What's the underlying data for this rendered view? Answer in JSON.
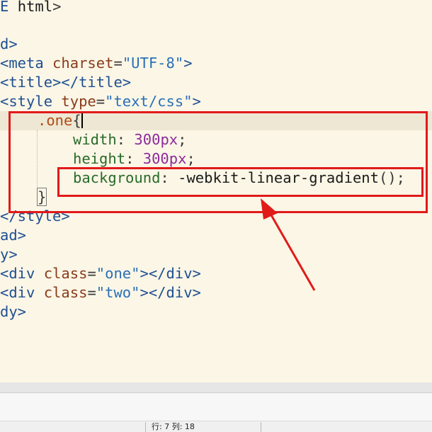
{
  "editor": {
    "lines": {
      "l1": {
        "a": "E ",
        "b": "html",
        "c": ">"
      },
      "l2": {
        "a": "d",
        "b": ">"
      },
      "l3": {
        "lt": "<",
        "tag": "meta",
        "attr": " charset",
        "eq": "=",
        "str": "\"UTF-8\"",
        "gt": ">"
      },
      "l4": {
        "text": "<title></title>"
      },
      "l5": {
        "lt": "<",
        "tag": "style",
        "attr": " type",
        "eq": "=",
        "str": "\"text/css\"",
        "gt": ">"
      },
      "l6": {
        "sel": ".one",
        "brace": "{"
      },
      "l7": {
        "prop": "width",
        "colon": ": ",
        "num": "300",
        "unit": "px",
        "semi": ";"
      },
      "l8": {
        "prop": "height",
        "colon": ": ",
        "num": "300",
        "unit": "px",
        "semi": ";"
      },
      "l9": {
        "prop": "background",
        "colon": ": ",
        "val": "-webkit-linear-gradient",
        "paren": "()",
        "semi": ";"
      },
      "l10": {
        "brace": "}"
      },
      "l11": {
        "text": "</style>"
      },
      "l12": {
        "text": "ad>"
      },
      "l13": {
        "text": "y>"
      },
      "l14": {
        "lt": "<",
        "tag": "div",
        "attr": " class",
        "eq": "=",
        "str": "\"one\"",
        "rest": "></div>"
      },
      "l15": {
        "lt": "<",
        "tag": "div",
        "attr": " class",
        "eq": "=",
        "str": "\"two\"",
        "rest": "></div>"
      },
      "l16": {
        "text": "dy>"
      }
    }
  },
  "status_bar": {
    "position": "行: 7 列: 18"
  },
  "colors": {
    "annotation": "#e11a1a",
    "background": "#fbf6e6"
  }
}
